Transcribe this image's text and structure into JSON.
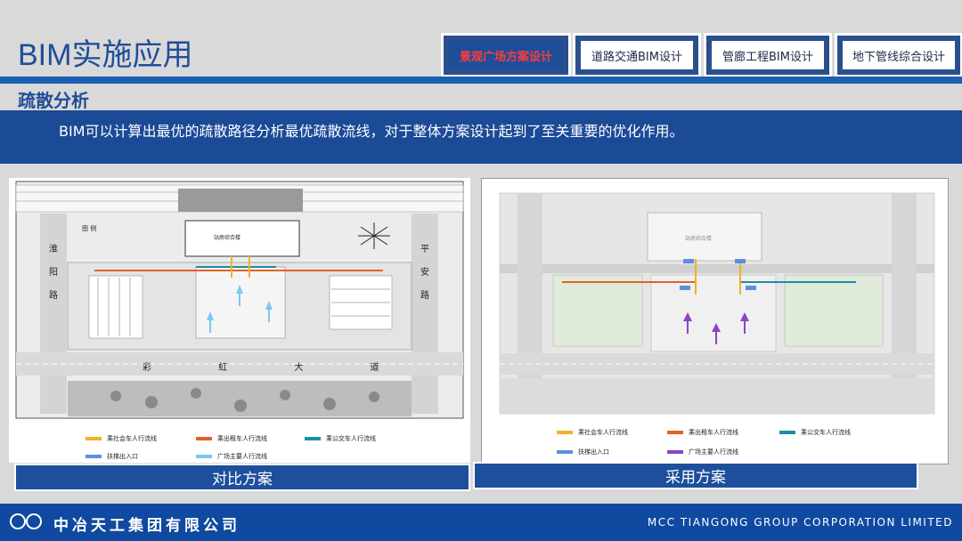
{
  "header": {
    "title": "BIM实施应用",
    "tabs": [
      {
        "label": "景观广场方案设计",
        "active": true
      },
      {
        "label": "道路交通BIM设计",
        "active": false
      },
      {
        "label": "管廊工程BIM设计",
        "active": false
      },
      {
        "label": "地下管线综合设计",
        "active": false
      }
    ]
  },
  "section": {
    "title": "疏散分析",
    "description": "BIM可以计算出最优的疏散路径分析最优疏散流线，对于整体方案设计起到了至关重要的优化作用。"
  },
  "left_plan": {
    "caption": "对比方案",
    "building_label": "站房综合楼",
    "legend_title": "图 例",
    "street_left": "淮 阳 路",
    "street_right": "平 安 路",
    "street_bottom": "彩 虹 大 道",
    "legend": [
      {
        "label": "乘社会车人行流线",
        "color": "#f0b323"
      },
      {
        "label": "乘出租车人行流线",
        "color": "#e0622a"
      },
      {
        "label": "乘公交车人行流线",
        "color": "#1a8ea6"
      },
      {
        "label": "扶梯出入口",
        "color": "#5b8fe0"
      },
      {
        "label": "广场主要人行流线",
        "color": "#7ec6f0"
      }
    ]
  },
  "right_plan": {
    "caption": "采用方案",
    "building_label": "站房综合楼",
    "legend": [
      {
        "label": "乘社会车人行流线",
        "color": "#f0b323"
      },
      {
        "label": "乘出租车人行流线",
        "color": "#e0622a"
      },
      {
        "label": "乘公交车人行流线",
        "color": "#1a8ea6"
      },
      {
        "label": "扶梯出入口",
        "color": "#5b8fe0"
      },
      {
        "label": "广场主要人行流线",
        "color": "#8a44c4"
      }
    ]
  },
  "footer": {
    "company_cn": "中冶天工集团有限公司",
    "company_en": "MCC TIANGONG GROUP CORPORATION LIMITED"
  },
  "colors": {
    "brand_blue": "#1f4e98",
    "active_tab_text": "#ff3b3b"
  }
}
